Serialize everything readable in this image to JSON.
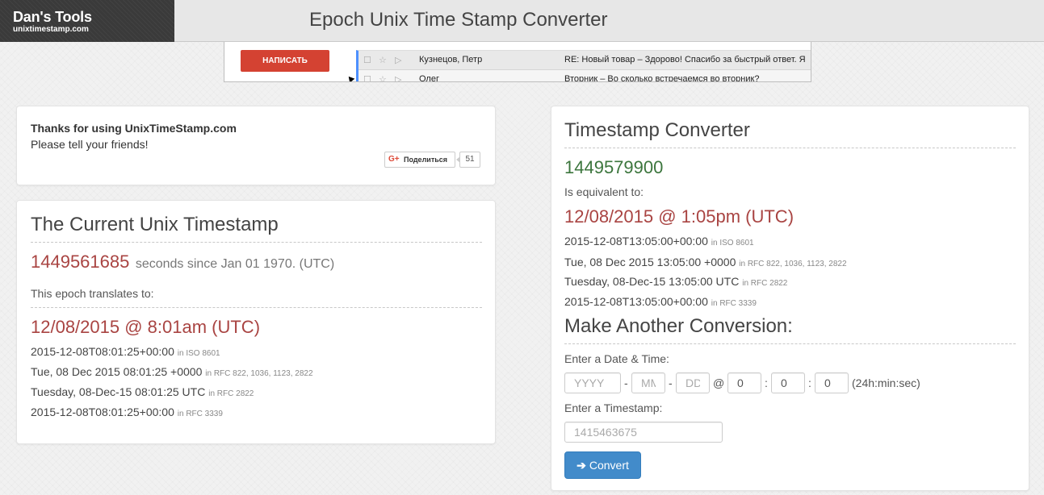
{
  "header": {
    "logo_title": "Dan's Tools",
    "logo_subtitle": "unixtimestamp.com",
    "page_title": "Epoch Unix Time Stamp Converter"
  },
  "ad": {
    "compose_label": "НАПИСАТЬ",
    "row1_sender": "Кузнецов, Петр",
    "row1_subject": "RE: Новый товар – Здорово! Спасибо за быстрый ответ. Я",
    "row2_sender": "Олег",
    "row2_subject": "Вторник – Во сколько встречаемся во вторник?"
  },
  "thanks": {
    "title": "Thanks for using UnixTimeStamp.com",
    "text": "Please tell your friends!",
    "share_label": "Поделиться",
    "share_count": "51"
  },
  "current": {
    "title": "The Current Unix Timestamp",
    "timestamp": "1449561685",
    "since_text": "seconds since Jan 01 1970. (UTC)",
    "translates_label": "This epoch translates to:",
    "human_date": "12/08/2015 @ 8:01am (UTC)",
    "formats": [
      {
        "value": "2015-12-08T08:01:25+00:00",
        "note": "in ISO 8601"
      },
      {
        "value": "Tue, 08 Dec 2015 08:01:25 +0000",
        "note": "in RFC 822, 1036, 1123, 2822"
      },
      {
        "value": "Tuesday, 08-Dec-15 08:01:25 UTC",
        "note": "in RFC 2822"
      },
      {
        "value": "2015-12-08T08:01:25+00:00",
        "note": "in RFC 3339"
      }
    ]
  },
  "converter": {
    "title": "Timestamp Converter",
    "timestamp": "1449579900",
    "equivalent_label": "Is equivalent to:",
    "human_date": "12/08/2015 @ 1:05pm (UTC)",
    "formats": [
      {
        "value": "2015-12-08T13:05:00+00:00",
        "note": "in ISO 8601"
      },
      {
        "value": "Tue, 08 Dec 2015 13:05:00 +0000",
        "note": "in RFC 822, 1036, 1123, 2822"
      },
      {
        "value": "Tuesday, 08-Dec-15 13:05:00 UTC",
        "note": "in RFC 2822"
      },
      {
        "value": "2015-12-08T13:05:00+00:00",
        "note": "in RFC 3339"
      }
    ],
    "another_title": "Make Another Conversion:",
    "date_label": "Enter a Date & Time:",
    "year_placeholder": "YYYY",
    "month_placeholder": "MM",
    "day_placeholder": "DD",
    "dash": "-",
    "at": "@",
    "colon": ":",
    "hour_value": "0",
    "minute_value": "0",
    "second_value": "0",
    "time_hint": "(24h:min:sec)",
    "timestamp_label": "Enter a Timestamp:",
    "timestamp_placeholder": "1415463675",
    "convert_label": "Convert"
  }
}
